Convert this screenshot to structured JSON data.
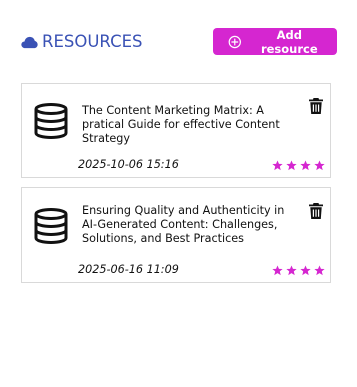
{
  "header": {
    "title": "RESOURCES",
    "add_button_label": "Add resource",
    "accent_color": "#d526d0",
    "title_color": "#3a52b5"
  },
  "resources": [
    {
      "title": "The Content Marketing Matrix: A pratical Guide for effective Content Strategy",
      "date": "2025-10-06 15:16",
      "rating": 4,
      "icon": "database-icon"
    },
    {
      "title": "Ensuring Quality and Authenticity in AI-Generated Content: Challenges, Solutions, and Best Practices",
      "date": "2025-06-16 11:09",
      "rating": 4,
      "icon": "database-icon"
    }
  ],
  "icons": {
    "title": "cloud-icon",
    "add": "plus-circle-icon",
    "delete": "trash-icon",
    "rating": "star-icon"
  }
}
